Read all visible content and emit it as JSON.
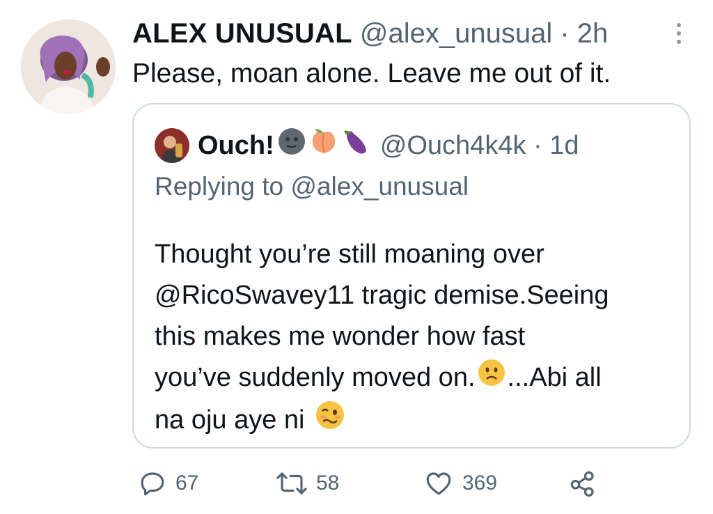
{
  "tweet": {
    "author_name": "ALEX UNUSUAL",
    "meta": "@alex_unusual · 2h",
    "text": "Please, moan alone. Leave me out of it."
  },
  "quoted": {
    "author_name": "Ouch!",
    "emojis": [
      "new-moon-face-emoji",
      "peach-emoji",
      "eggplant-emoji"
    ],
    "meta": "@Ouch4k4k · 1d",
    "replying_prefix": "Replying to ",
    "replying_handle": "@alex_unusual",
    "lines": [
      "Thought you’re still moaning over",
      "@RicoSwavey11 tragic demise.Seeing",
      "this makes me wonder how fast",
      "you’ve suddenly moved on.",
      "...Abi all",
      "na oju aye ni"
    ]
  },
  "actions": {
    "replies": "67",
    "retweets": "58",
    "likes": "369"
  },
  "colors": {
    "text": "#0f1419",
    "secondary": "#536471",
    "border": "#cfd9de"
  },
  "icons": [
    "more-icon",
    "reply-icon",
    "retweet-icon",
    "like-icon",
    "share-icon"
  ]
}
